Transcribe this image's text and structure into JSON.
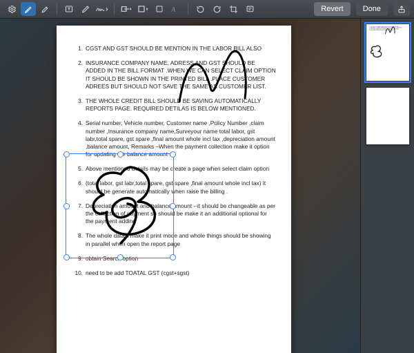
{
  "toolbar": {
    "revert_label": "Revert",
    "done_label": "Done"
  },
  "doc": {
    "items": [
      {
        "n": "1.",
        "t": "CGST AND GST SHOULD BE MENTION IN THE LABOR BILL ALSO"
      },
      {
        "n": "2.",
        "t": "INSURANCE COMPANY NAME, ADRESS AND GST SHOULD BE ADDED IN THE BILL FORMAT .WHEN WE CAN SELECT CLAIM OPTION IT SHOULD BE SHOWN IN THE PRINTED BILL .PLACE CUSTOMER ADREES BUT SHOULD NOT SAVE THE SAME AS CUSTOMER LIST."
      },
      {
        "n": "3.",
        "t": "THE WHOLE CREDIT BILL SHOULD BE SAVING AUTOMATICALLY REPORTS PAGE.  REQUIRED DETILAS IS BELOW MENTIONED."
      },
      {
        "n": "4.",
        "t": "Serial number, Vehicle number, Customer name ,Policy Number ,claim number ,Insurance company name,Surveyour name total labor, gst labr,total spare, gst spare ,final amount whole incl tax ,depreciation amount ,balance amount, Remarks –When the payment collection make it option for updating the balance amount ."
      },
      {
        "n": "5.",
        "t": "Above mentioned details may be create a page when select claim option"
      },
      {
        "n": "6.",
        "t": "(total labor, gst labr,total spare, gst spare ,final amount whole incl tax) it should be generate automatically when raise the billing ."
      },
      {
        "n": "7.",
        "t": "Depreciation amount and balance amount  --it should be changeable as per the collection of payment so should be make it an additional optional for the  payment adding"
      },
      {
        "n": "8.",
        "t": "The whole data's make it print mode and whole things should be showing in parallel when open the report page"
      },
      {
        "n": "9.",
        "t": "obtain Search option"
      },
      {
        "n": "10.",
        "t": "   need to be add TOATAL GST (cgst+sgst)"
      }
    ]
  }
}
